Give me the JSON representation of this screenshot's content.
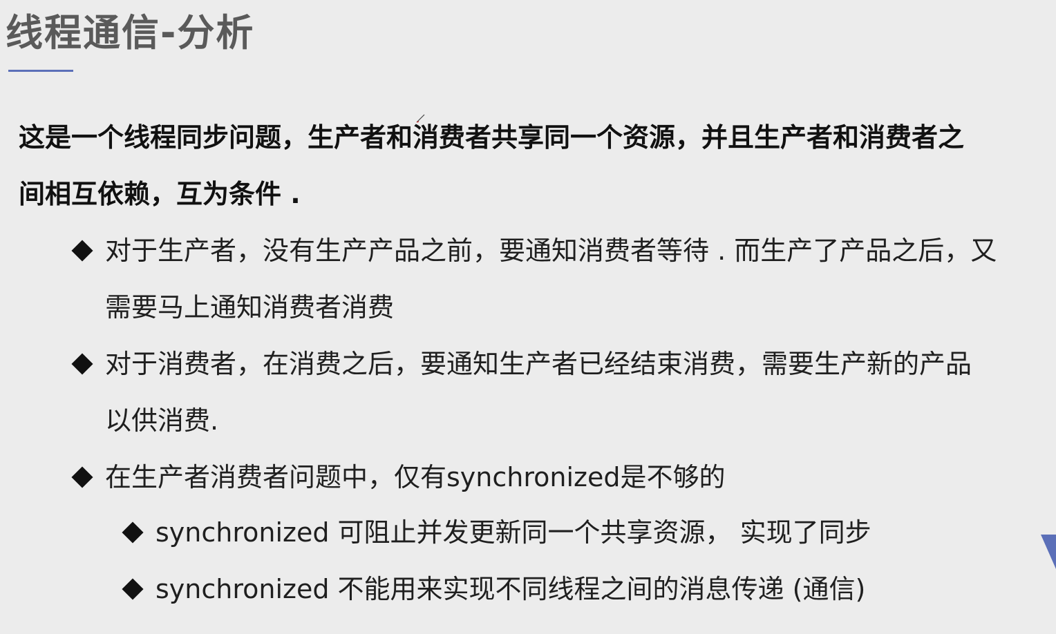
{
  "slide": {
    "title": "线程通信-分析",
    "intro": {
      "line1": "这是一个线程同步问题，生产者和消费者共享同一个资源，并且生产者和消费者之",
      "line2": "间相互依赖，互为条件 ."
    },
    "bullets": [
      {
        "line1": "对于生产者，没有生产产品之前，要通知消费者等待 . 而生产了产品之后，又",
        "line2": "需要马上通知消费者消费"
      },
      {
        "line1": "对于消费者，在消费之后，要通知生产者已经结束消费，需要生产新的产品",
        "line2": "以供消费."
      },
      {
        "line1": "在生产者消费者问题中，仅有synchronized是不够的"
      }
    ],
    "sub_bullets": [
      {
        "text": "synchronized 可阻止并发更新同一个共享资源， 实现了同步"
      },
      {
        "text": "synchronized 不能用来实现不同线程之间的消息传递 (通信)"
      }
    ]
  },
  "colors": {
    "background": "#ececec",
    "title": "#5a5a5a",
    "accent": "#5b6fb8",
    "text": "#1f1f1f"
  },
  "icons": {
    "bullet": "diamond-bullet-icon",
    "pen": "pen-cursor-icon"
  }
}
